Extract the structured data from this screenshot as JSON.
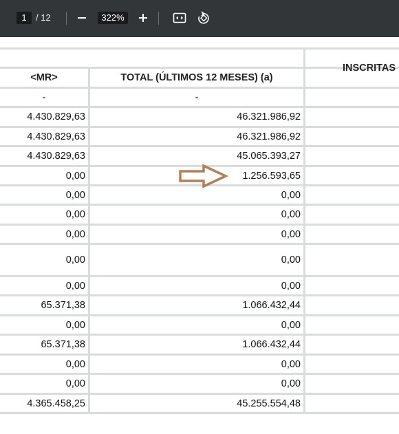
{
  "toolbar": {
    "page_current": "1",
    "page_total": "/ 12",
    "zoom": "322%",
    "zoom_out_icon": "minus-icon",
    "zoom_in_icon": "plus-icon",
    "fit_icon": "fit-to-page-icon",
    "rotate_icon": "rotate-icon"
  },
  "table": {
    "header_group": "INSCRITAS",
    "col_mr": "<MR>",
    "col_total": "TOTAL (ÚLTIMOS 12 MESES) (a)",
    "rows": [
      {
        "mr": "-",
        "total": "-"
      },
      {
        "mr": "4.430.829,63",
        "total": "46.321.986,92"
      },
      {
        "mr": "4.430.829,63",
        "total": "46.321.986,92"
      },
      {
        "mr": "4.430.829,63",
        "total": "45.065.393,27"
      },
      {
        "mr": "0,00",
        "total": "1.256.593,65"
      },
      {
        "mr": "0,00",
        "total": "0,00"
      },
      {
        "mr": "0,00",
        "total": "0,00"
      },
      {
        "mr": "0,00",
        "total": "0,00"
      },
      {
        "mr": "0,00",
        "total": "0,00"
      },
      {
        "mr": "0,00",
        "total": "0,00"
      },
      {
        "mr": "65.371,38",
        "total": "1.066.432,44"
      },
      {
        "mr": "0,00",
        "total": "0,00"
      },
      {
        "mr": "65.371,38",
        "total": "1.066.432,44"
      },
      {
        "mr": "0,00",
        "total": "0,00"
      },
      {
        "mr": "0,00",
        "total": "0,00"
      },
      {
        "mr": "4.365.458,25",
        "total": "45.255.554,48"
      }
    ]
  },
  "annotation": {
    "arrow_color": "#b87d52",
    "arrow_icon": "right-arrow-icon"
  },
  "colors": {
    "toolbar_bg": "#323639",
    "grid_line": "#d9dcdc"
  }
}
